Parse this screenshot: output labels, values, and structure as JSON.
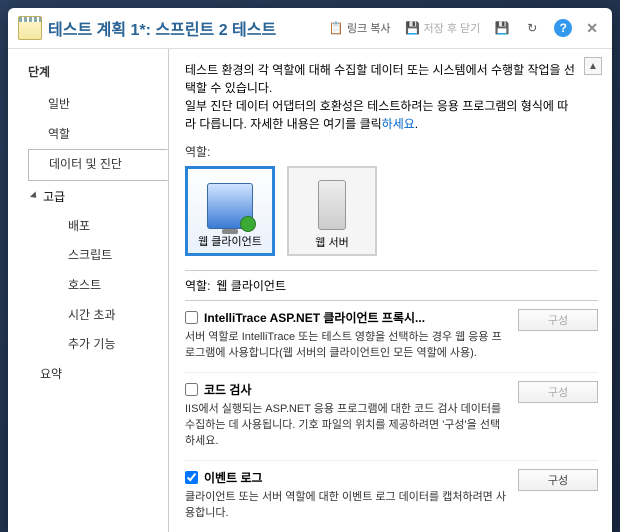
{
  "titlebar": {
    "title": "테스트 계획 1*: 스프린트 2 테스트",
    "copy_link": "링크 복사",
    "save_close": "저장 후 닫기"
  },
  "sidebar": {
    "heading": "단계",
    "items": {
      "general": "일반",
      "role": "역할",
      "data_diag": "데이터 및 진단",
      "advanced": "고급",
      "deploy": "배포",
      "script": "스크립트",
      "host": "호스트",
      "timeout": "시간 초과",
      "addons": "추가 기능",
      "summary": "요약"
    }
  },
  "main": {
    "desc_line1": "테스트 환경의 각 역할에 대해 수집할 데이터 또는 시스템에서 수행할 작업을 선택할 수 있습니다.",
    "desc_line2_a": "일부 진단 데이터 어댑터의 호환성은 테스트하려는 응용 프로그램의 형식에 따라 다릅니다. 자세한 내용은 여기를 클릭",
    "desc_link": "하세요",
    "desc_period": ".",
    "roles_label": "역할:",
    "tiles": {
      "web_client": "웹 클라이언트",
      "web_server": "웹 서버"
    },
    "selected_role_label": "역할:",
    "selected_role_value": "웹 클라이언트",
    "adapters": [
      {
        "title": "IntelliTrace ASP.NET 클라이언트 프록시...",
        "desc": "서버 역할로 IntelliTrace 또는 테스트 영향을 선택하는 경우 웹 응용 프로그램에 사용합니다(웹 서버의 클라이언트인 모든 역할에 사용).",
        "checked": false,
        "configure": "구성",
        "configure_enabled": false
      },
      {
        "title": "코드 검사",
        "desc": "IIS에서 실행되는 ASP.NET 응용 프로그램에 대한 코드 검사 데이터를 수집하는 데 사용됩니다. 기호 파일의 위치를 제공하려면 '구성'을 선택하세요.",
        "checked": false,
        "configure": "구성",
        "configure_enabled": false
      },
      {
        "title": "이벤트 로그",
        "desc": "클라이언트 또는 서버 역할에 대한 이벤트 로그 데이터를 캡처하려면 사용합니다.",
        "checked": true,
        "configure": "구성",
        "configure_enabled": true
      }
    ]
  }
}
